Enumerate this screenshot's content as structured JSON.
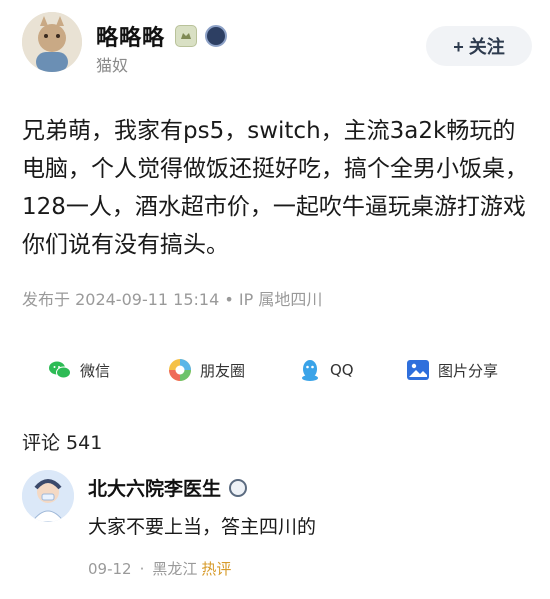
{
  "user": {
    "name": "略略略",
    "subtitle": "猫奴"
  },
  "follow_button": {
    "label": "+ 关注"
  },
  "post": {
    "text": "兄弟萌，我家有ps5，switch，主流3a2k畅玩的电脑，个人觉得做饭还挺好吃，搞个全男小饭桌，128一人，酒水超市价，一起吹牛逼玩桌游打游戏你们说有没有搞头。",
    "meta": "发布于 2024-09-11 15:14 • IP 属地四川"
  },
  "share": [
    {
      "label": "微信",
      "icon": "wechat-icon"
    },
    {
      "label": "朋友圈",
      "icon": "moments-icon"
    },
    {
      "label": "QQ",
      "icon": "qq-icon"
    },
    {
      "label": "图片分享",
      "icon": "image-share-icon"
    }
  ],
  "comments": {
    "title": "评论 541",
    "items": [
      {
        "author": "北大六院李医生",
        "text": "大家不要上当，答主四川的",
        "date": "09-12",
        "sep": "·",
        "location": "黑龙江",
        "tag": "热评"
      }
    ]
  },
  "colors": {
    "text": "#1a1a1a",
    "muted": "#9a9a9a",
    "hot": "#d79b2b",
    "follow_bg": "#f1f3f6"
  }
}
